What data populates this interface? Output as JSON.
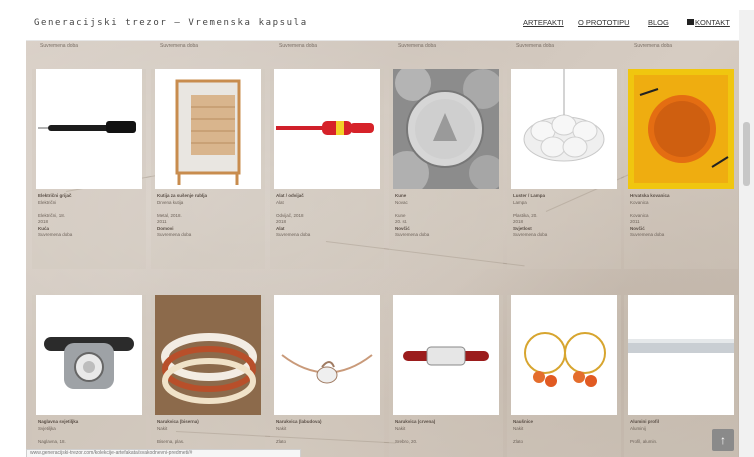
{
  "site": {
    "title": "Generacijski trezor – Vremenska kapsula"
  },
  "nav": {
    "items": [
      {
        "label": "ARTEFAKTI"
      },
      {
        "label": "O PROTOTIPU"
      },
      {
        "label": "BLOG"
      },
      {
        "label": "KONTAKT",
        "icon": "envelope-icon"
      }
    ]
  },
  "top_labels": [
    "Suvremena doba",
    "Suvremena doba",
    "Suvremena doba",
    "Suvremena doba",
    "Suvremena doba",
    "Suvremena doba"
  ],
  "row1": [
    {
      "name": "Električni grijač",
      "lines": [
        "Električni",
        "",
        "Električni, 18.",
        "2018"
      ],
      "bold": "Kuća",
      "era": "Suvremena doba"
    },
    {
      "name": "Kutija za sušenje rublja",
      "lines": [
        "Drvena kutija",
        "",
        "Metal, 2018.",
        "2011"
      ],
      "bold": "Domovi",
      "era": "Suvremena doba"
    },
    {
      "name": "Alat / odvijač",
      "lines": [
        "Alat",
        "",
        "Odvijač, 2018",
        "2018"
      ],
      "bold": "Alat",
      "era": "Suvremena doba"
    },
    {
      "name": "Kune",
      "lines": [
        "Novac",
        "",
        "Kune",
        "20. st."
      ],
      "bold": "Novčić",
      "era": "Suvremena doba"
    },
    {
      "name": "Luster / Lampa",
      "lines": [
        "Lampa",
        "",
        "Plastika, 20.",
        "2018"
      ],
      "bold": "Svjetlost",
      "era": "Suvremena doba"
    },
    {
      "name": "Hrvatska kovanica",
      "lines": [
        "Kovanica",
        "",
        "Kovanica",
        "2011"
      ],
      "bold": "Novčić",
      "era": "Suvremena doba"
    }
  ],
  "row2": [
    {
      "name": "Naglavna svjetiljka",
      "lines": [
        "Svjetiljka",
        "",
        "Naglavna, 18."
      ]
    },
    {
      "name": "Narukvica (biserna)",
      "lines": [
        "Nakit",
        "",
        "Biserna, plas."
      ]
    },
    {
      "name": "Narukvica (labudova)",
      "lines": [
        "Nakit",
        "",
        "Zlato"
      ]
    },
    {
      "name": "Narukvica (crvena)",
      "lines": [
        "Nakit",
        "",
        "Srebro, 20."
      ]
    },
    {
      "name": "Naušnice",
      "lines": [
        "Nakit",
        "",
        "Zlato"
      ]
    },
    {
      "name": "Alumini profil",
      "lines": [
        "Aluminij",
        "",
        "Profil, alumin."
      ]
    }
  ],
  "status": {
    "url": "www.generacijski-trezor.com/kolekcije-artefakata/svakodnevni-predmeti/#"
  },
  "colors": {
    "accent": "#d8232a",
    "stone": "#d2c8be"
  }
}
